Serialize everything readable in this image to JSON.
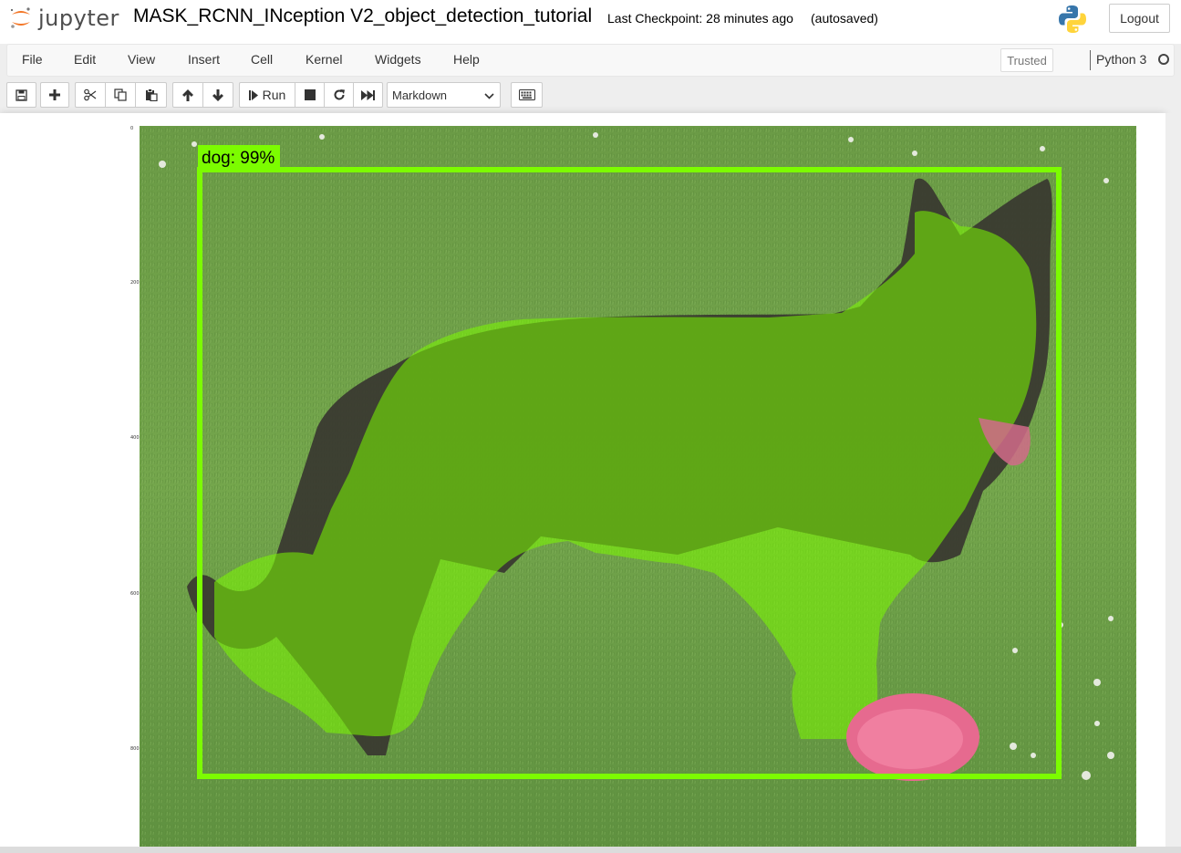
{
  "header": {
    "logo_text": "jupyter",
    "notebook_name": "MASK_RCNN_INception V2_object_detection_tutorial",
    "checkpoint": "Last Checkpoint: 28 minutes ago",
    "autosave": "(autosaved)",
    "logout_label": "Logout"
  },
  "menubar": {
    "items": [
      "File",
      "Edit",
      "View",
      "Insert",
      "Cell",
      "Kernel",
      "Widgets",
      "Help"
    ],
    "trusted_label": "Trusted",
    "kernel_name": "Python 3"
  },
  "toolbar": {
    "icons": [
      "save-icon",
      "plus-icon",
      "scissors-icon",
      "copy-icon",
      "paste-icon",
      "arrow-up-icon",
      "arrow-down-icon",
      "step-forward-icon",
      "stop-icon",
      "restart-icon",
      "fast-forward-icon",
      "keyboard-icon"
    ],
    "run_label": "Run",
    "cell_type": "Markdown"
  },
  "output": {
    "detection_label": "dog: 99%",
    "box_color": "#7cfc00",
    "mask_color": "#7cfc00",
    "y_ticks": [
      "0",
      "200",
      "400",
      "600",
      "800"
    ]
  },
  "colors": {
    "accent_orange": "#f37626",
    "grass": "#6fa247"
  }
}
